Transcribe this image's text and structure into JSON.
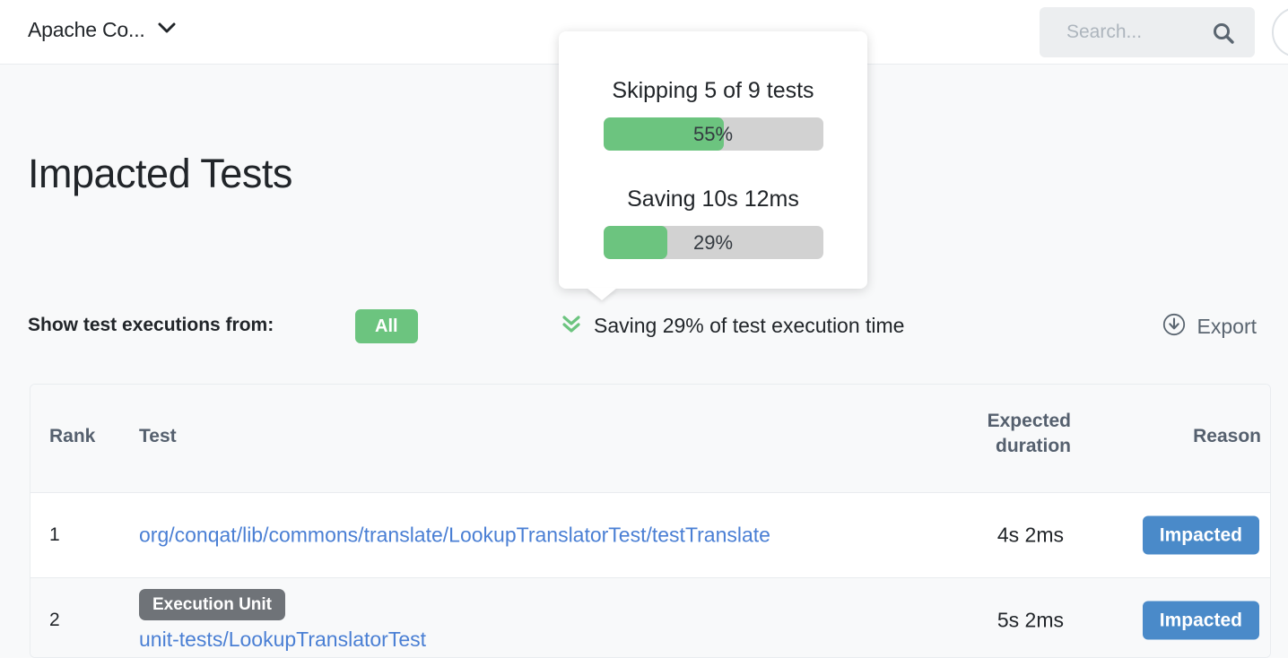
{
  "topbar": {
    "brand_label": "Apache Co...",
    "brand_chevron_icon": "chevron-down-icon",
    "search": {
      "placeholder": "Search...",
      "value": "",
      "icon": "search-icon"
    },
    "avatar_icon": "user-avatar-icon"
  },
  "page": {
    "title": "Impacted Tests"
  },
  "filters": {
    "label": "Show test executions from:",
    "all_badge": "All",
    "all_badge_color": "#6cc47f",
    "saving_icon": "angle-double-down-icon",
    "saving_text": "Saving 29% of test execution time",
    "export_icon": "download-circle-icon",
    "export_label": "Export"
  },
  "tooltip": {
    "skipping_heading": "Skipping 5 of 9 tests",
    "skipping_percent_label": "55%",
    "skipping_percent_value": 55,
    "saving_heading": "Saving 10s 12ms",
    "saving_percent_label": "29%",
    "saving_percent_value": 29,
    "fill_color": "#6cc47f",
    "track_color": "#d2d2d2"
  },
  "table": {
    "columns": {
      "rank": "Rank",
      "test": "Test",
      "duration_line1": "Expected",
      "duration_line2": "duration",
      "reason": "Reason"
    },
    "rows": [
      {
        "rank": "1",
        "exec_unit_badge": "",
        "test": "org/conqat/lib/commons/translate/LookupTranslatorTest/testTranslate",
        "duration": "4s 2ms",
        "reason": "Impacted",
        "reason_color": "#4a8ac9"
      },
      {
        "rank": "2",
        "exec_unit_badge": "Execution Unit",
        "test": "unit-tests/LookupTranslatorTest",
        "duration": "5s 2ms",
        "reason": "Impacted",
        "reason_color": "#4a8ac9"
      }
    ]
  }
}
